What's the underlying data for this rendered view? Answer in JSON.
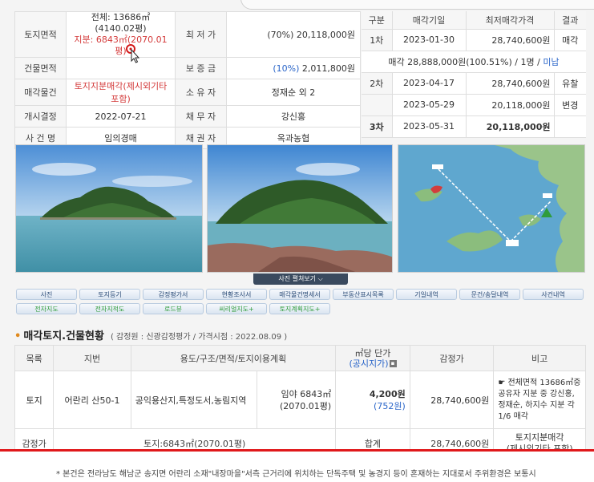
{
  "info": {
    "land_area_label": "토지면적",
    "land_area_total": "전체: 13686㎡(4140.02평)",
    "land_area_share": "지분: 6843㎡(2070.01평)",
    "min_price_label": "최 저 가",
    "min_price_value": "(70%) 20,118,000원",
    "building_area_label": "건물면적",
    "building_area_value": "",
    "deposit_label": "보 증 금",
    "deposit_pct": "(10%)",
    "deposit_value": "2,011,800원",
    "sale_item_label": "매각물건",
    "sale_item_value": "토지지분매각(제시외기타 포함)",
    "owner_label": "소 유 자",
    "owner_value": "정재순 외 2",
    "decision_label": "개시결정",
    "decision_value": "2022-07-21",
    "debtor_label": "채 무 자",
    "debtor_value": "강신홍",
    "case_label": "사 건 명",
    "case_value": "임의경매",
    "creditor_label": "채 권 자",
    "creditor_value": "옥과농협"
  },
  "history": {
    "headers": [
      "구분",
      "매각기일",
      "최저매각가격",
      "결과"
    ],
    "row1": {
      "round": "1차",
      "date": "2023-01-30",
      "price": "28,740,600원",
      "result": "매각"
    },
    "sale_note_a": "매각 28,888,000원(100.51%) / 1명 / ",
    "sale_note_b": "미납",
    "row2": {
      "round": "2차",
      "date": "2023-04-17",
      "price": "28,740,600원",
      "result": "유찰"
    },
    "row2b": {
      "date": "2023-05-29",
      "price": "20,118,000원",
      "result": "변경"
    },
    "row3": {
      "round": "3차",
      "date": "2023-05-31",
      "price": "20,118,000원",
      "result": ""
    }
  },
  "gallery_button": "사진 펼쳐보기",
  "tabs_row1": [
    "사진",
    "토지등기",
    "감정평가서",
    "현황조사서",
    "매각물건명세서",
    "부동산표시목록",
    "기일내역",
    "문건/송달내역",
    "사건내역"
  ],
  "tabs_row2": [
    "전자지도",
    "전자지적도",
    "로드뷰",
    "씨리얼지도+",
    "토지계획지도+"
  ],
  "section": {
    "title": "매각토지.건물현황",
    "subtitle": "( 감정원 : 신광감정평가 / 가격시점 : 2022.08.09 )"
  },
  "land_table": {
    "headers": {
      "item": "목록",
      "lot": "지번",
      "usage": "용도/구조/면적/토지이용계획",
      "unit_price": "㎡당 단가",
      "unit_price_sub": "(공시지가)",
      "appraisal": "감정가",
      "note": "비고"
    },
    "row": {
      "item": "토지",
      "lot": "어란리 산50-1",
      "usage": "공익용산지,특정도서,농림지역",
      "area1": "임야 6843㎡",
      "area2": "(2070.01평)",
      "unit_price": "4,200원",
      "public_price": "(752원)",
      "appraisal": "28,740,600원",
      "note": "☛ 전체면적 13686㎡중 공유자 지분 중 강신홍, 정재순, 하지수 지분 각 1/6 매각"
    },
    "total": {
      "label": "감정가",
      "land": "토지:6843㎡(2070.01평)",
      "sum_label": "합계",
      "sum": "28,740,600원",
      "note1": "토지지분매각",
      "note2": "(제시외기타 포함)"
    }
  },
  "footnote": "* 본건은 전라남도 해남군 송지면 어란리 소재\"내장마을\"서측 근거리에 위치하는 단독주택 및 농경지 등이 혼재하는 지대로서 주위환경은 보통시"
}
